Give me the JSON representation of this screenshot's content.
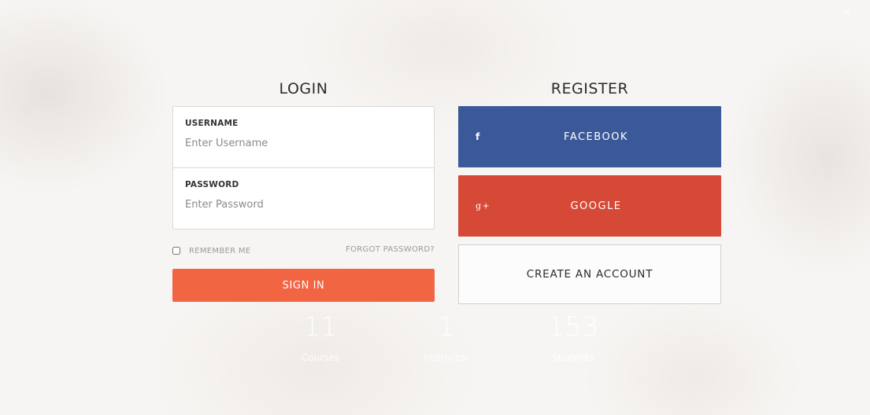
{
  "login": {
    "title": "LOGIN",
    "username_label": "USERNAME",
    "username_placeholder": "Enter Username",
    "password_label": "PASSWORD",
    "password_placeholder": "Enter Password",
    "remember_label": "REMEMBER ME",
    "forgot_label": "FORGOT PASSWORD?",
    "signin_label": "SIGN IN"
  },
  "register": {
    "title": "REGISTER",
    "facebook_label": "FACEBOOK",
    "facebook_icon": "f",
    "google_label": "GOOGLE",
    "google_icon": "g+",
    "create_label": "CREATE AN ACCOUNT"
  },
  "background_stats": [
    {
      "value": "11",
      "label": "Courses"
    },
    {
      "value": "1",
      "label": "Instructor"
    },
    {
      "value": "153",
      "label": "Students"
    }
  ],
  "colors": {
    "signin": "#f26543",
    "facebook": "#3b5998",
    "google": "#d64937"
  }
}
